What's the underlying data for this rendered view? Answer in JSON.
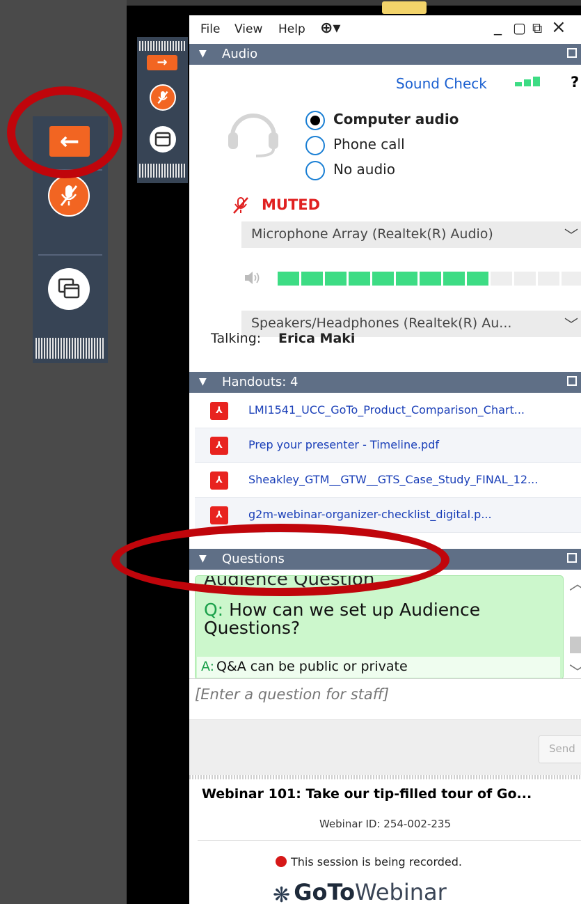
{
  "menu": {
    "file": "File",
    "view": "View",
    "help": "Help",
    "globe_label": "⊕▾"
  },
  "window_controls": {
    "minimize": "_",
    "maximize": "▢",
    "popout": "⧉",
    "close": "×"
  },
  "audio": {
    "title": "Audio",
    "sound_check": "Sound Check",
    "help_glyph": "?",
    "options": [
      "Computer audio",
      "Phone call",
      "No audio"
    ],
    "selected": "Computer audio",
    "status": "MUTED",
    "microphone": "Microphone Array (Realtek(R) Audio)",
    "speakers": "Speakers/Headphones (Realtek(R) Au...",
    "speaker_level_fraction": 0.6,
    "talking_label": "Talking:",
    "talking_name": "Erica Maki",
    "colors": {
      "muted": "#e02020",
      "level_on": "#3ddc84",
      "level_off": "#eeeeee",
      "link": "#1a5fd0"
    }
  },
  "handouts": {
    "title": "Handouts: 4",
    "files": [
      "LMI1541_UCC_GoTo_Product_Comparison_Chart...",
      "Prep your presenter - Timeline.pdf",
      "Sheakley_GTM__GTW__GTS_Case_Study_FINAL_12...",
      "g2m-webinar-organizer-checklist_digital.p..."
    ]
  },
  "questions": {
    "title": "Questions",
    "card_heading": "Audience Question",
    "q_prefix": "Q:",
    "q_text": "How can we set up Audience Questions?",
    "a_prefix": "A:",
    "a_text": "Q&A can be public or private",
    "input_placeholder": "[Enter a question for staff]",
    "send_label": "Send"
  },
  "footer": {
    "webinar_title": "Webinar 101:  Take our tip-filled tour of Go...",
    "webinar_id": "Webinar ID: 254-002-235",
    "recording_notice": "This session is being recorded.",
    "brand_goto": "GoTo",
    "brand_webinar": "Webinar"
  },
  "toolbar": {
    "expand_icon": "→",
    "collapse_icon": "←"
  },
  "accent": "#f26522"
}
